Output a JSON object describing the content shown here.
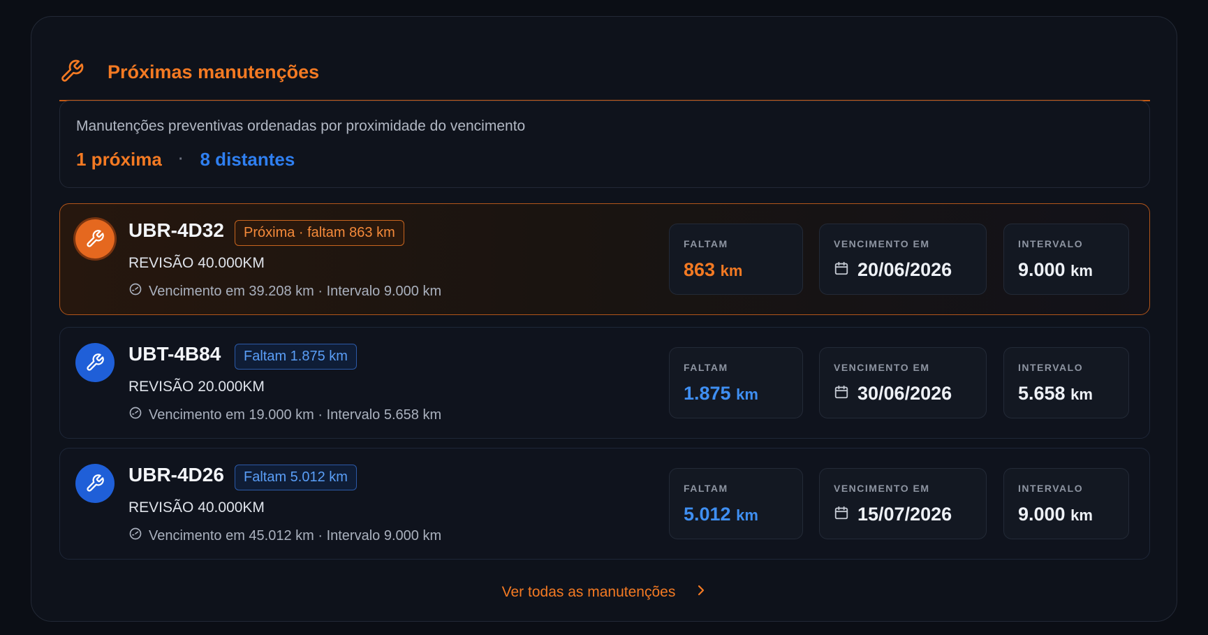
{
  "header": {
    "title": "Próximas manutenções",
    "icon": "wrench-icon"
  },
  "summary": {
    "description": "Manutenções preventivas ordenadas por proximidade do vencimento",
    "near_count": "1 próxima",
    "separator": "·",
    "far_count": "8 distantes"
  },
  "labels": {
    "faltam": "FALTAM",
    "vencimento": "VENCIMENTO EM",
    "intervalo": "INTERVALO",
    "unit": "km"
  },
  "items": [
    {
      "plate": "UBR-4D32",
      "badge": "Próxima · faltam 863 km",
      "service": "REVISÃO 40.000KM",
      "meta": "Vencimento em 39.208 km · Intervalo 9.000 km",
      "faltam": "863",
      "due_date": "20/06/2026",
      "interval": "9.000"
    },
    {
      "plate": "UBT-4B84",
      "badge": "Faltam 1.875 km",
      "service": "REVISÃO 20.000KM",
      "meta": "Vencimento em 19.000 km · Intervalo 5.658 km",
      "faltam": "1.875",
      "due_date": "30/06/2026",
      "interval": "5.658"
    },
    {
      "plate": "UBR-4D26",
      "badge": "Faltam 5.012 km",
      "service": "REVISÃO 40.000KM",
      "meta": "Vencimento em 45.012 km · Intervalo 9.000 km",
      "faltam": "5.012",
      "due_date": "15/07/2026",
      "interval": "9.000"
    }
  ],
  "footer": {
    "link": "Ver todas as manutenções"
  },
  "colors": {
    "accent": "#f47a23",
    "blue": "#2f7ff0",
    "background": "#0b0e15"
  }
}
